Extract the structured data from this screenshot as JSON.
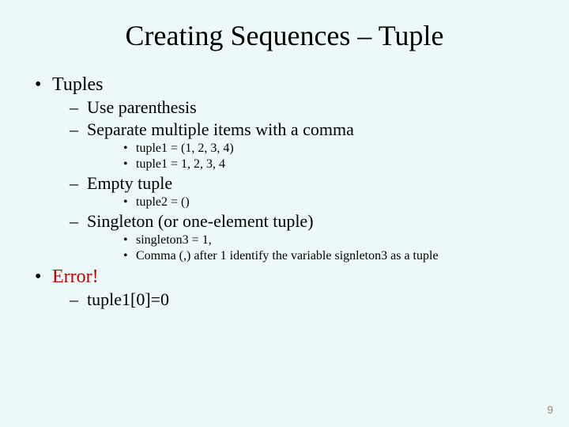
{
  "title": "Creating Sequences – Tuple",
  "bullets": {
    "tuples": {
      "label": "Tuples",
      "sub": {
        "useParen": "Use parenthesis",
        "separate": "Separate multiple items with a comma",
        "ex1": "tuple1 = (1, 2, 3, 4)",
        "ex2": "tuple1 = 1, 2, 3, 4",
        "empty": "Empty tuple",
        "ex3": "tuple2 = ()",
        "singleton": "Singleton (or one-element tuple)",
        "ex4": "singleton3 = 1,",
        "ex5": "Comma (,) after 1 identify the variable signleton3 as a tuple"
      }
    },
    "error": {
      "label": "Error!",
      "sub": {
        "line": "tuple1[0]=0"
      }
    }
  },
  "pageNumber": "9"
}
